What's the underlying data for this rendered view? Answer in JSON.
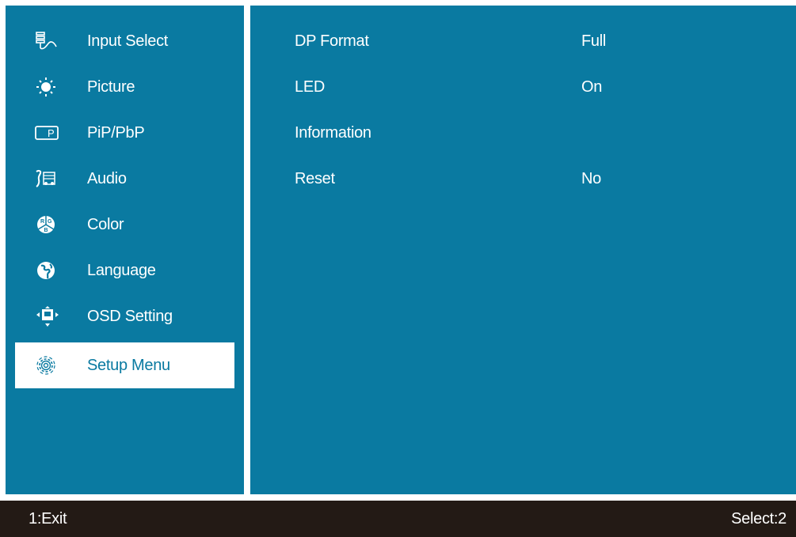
{
  "sidebar": {
    "items": [
      {
        "label": "Input Select",
        "icon": "input-select-icon"
      },
      {
        "label": "Picture",
        "icon": "brightness-icon"
      },
      {
        "label": "PiP/PbP",
        "icon": "pip-icon"
      },
      {
        "label": "Audio",
        "icon": "audio-icon"
      },
      {
        "label": "Color",
        "icon": "rgb-color-icon"
      },
      {
        "label": "Language",
        "icon": "globe-icon"
      },
      {
        "label": "OSD Setting",
        "icon": "osd-setting-icon"
      },
      {
        "label": "Setup Menu",
        "icon": "gear-icon",
        "selected": true
      }
    ]
  },
  "main": {
    "rows": [
      {
        "name": "DP Format",
        "value": "Full"
      },
      {
        "name": "LED",
        "value": "On"
      },
      {
        "name": "Information",
        "value": ""
      },
      {
        "name": "Reset",
        "value": "No"
      }
    ]
  },
  "footer": {
    "left": "1:Exit",
    "right": "Select:2"
  },
  "colors": {
    "panel": "#0a7aa1",
    "footer": "#231a15",
    "selected_bg": "#ffffff",
    "text": "#ffffff"
  }
}
